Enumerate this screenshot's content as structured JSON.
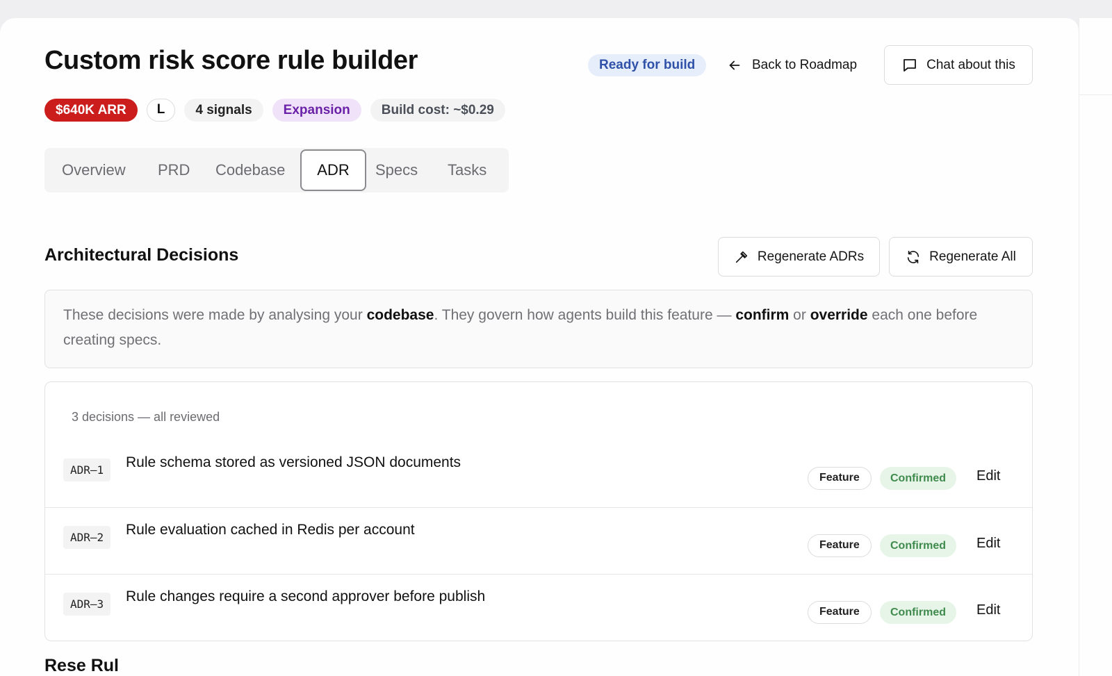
{
  "header": {
    "title": "Custom risk score rule builder",
    "status": "Ready for build",
    "back_label": "Back to Roadmap",
    "chat_label": "Chat about this"
  },
  "meta": {
    "arr": "$640K ARR",
    "size": "L",
    "signals": "4 signals",
    "category": "Expansion",
    "build_cost": "Build cost: ~$0.29"
  },
  "tabs": [
    {
      "label": "Overview",
      "active": false
    },
    {
      "label": "PRD",
      "active": false
    },
    {
      "label": "Codebase",
      "active": false
    },
    {
      "label": "ADR",
      "active": true
    },
    {
      "label": "Specs",
      "active": false
    },
    {
      "label": "Tasks",
      "active": false
    }
  ],
  "section": {
    "title": "Architectural Decisions",
    "regenerate_adrs_label": "Regenerate ADRs",
    "regenerate_all_label": "Regenerate All"
  },
  "info": {
    "part1": "These decisions were made by analysing your ",
    "kw1": "codebase",
    "part2": ". They govern how agents build this feature — ",
    "kw2": "confirm",
    "part3": " or ",
    "kw3": "override",
    "part4": " each one before creating specs."
  },
  "decisions": {
    "count_label": "3 decisions — all reviewed",
    "items": [
      {
        "id": "ADR–1",
        "title": "Rule schema stored as versioned JSON documents",
        "type": "Feature",
        "status": "Confirmed",
        "action": "Edit"
      },
      {
        "id": "ADR–2",
        "title": "Rule evaluation cached in Redis per account",
        "type": "Feature",
        "status": "Confirmed",
        "action": "Edit"
      },
      {
        "id": "ADR–3",
        "title": "Rule changes require a second approver before publish",
        "type": "Feature",
        "status": "Confirmed",
        "action": "Edit"
      }
    ]
  },
  "next_section": {
    "title": "Rese Rul"
  },
  "colors": {
    "arr_badge": "#cc1d1d",
    "status_pill_bg": "#e6edfb",
    "status_pill_text": "#2f52a8",
    "expansion_bg": "#f0e3f9",
    "expansion_text": "#6a21a8",
    "confirmed_bg": "#e7f5e8",
    "confirmed_text": "#3f8a4d"
  },
  "icons": {
    "back": "arrow-left-icon",
    "chat": "chat-bubble-icon",
    "regenerate_adrs": "hammer-icon",
    "regenerate_all": "refresh-icon"
  }
}
